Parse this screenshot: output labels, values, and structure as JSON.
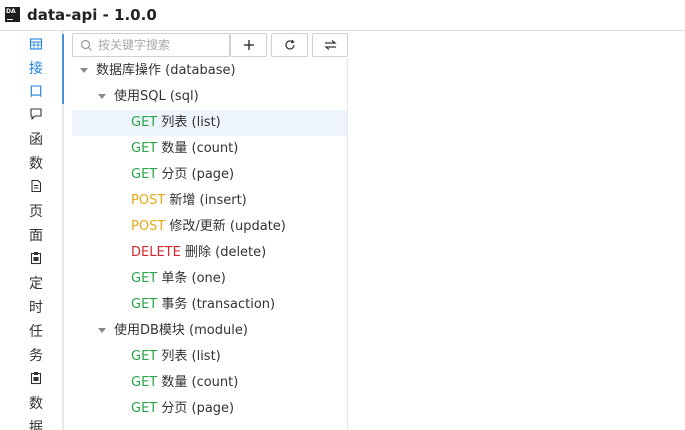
{
  "app": {
    "logo_text": "DA",
    "title": "data-api - 1.0.0"
  },
  "sidebar": {
    "items": [
      {
        "icon": "table-icon"
      },
      {
        "label": "接"
      },
      {
        "label": "口"
      },
      {
        "icon": "comment-icon"
      },
      {
        "label": "函"
      },
      {
        "label": "数"
      },
      {
        "icon": "document-icon"
      },
      {
        "label": "页"
      },
      {
        "label": "面"
      },
      {
        "icon": "clipboard-icon"
      },
      {
        "label": "定"
      },
      {
        "label": "时"
      },
      {
        "label": "任"
      },
      {
        "label": "务"
      },
      {
        "icon": "clipboard-icon"
      },
      {
        "label": "数"
      },
      {
        "label": "据"
      }
    ]
  },
  "toolbar": {
    "search_placeholder": "按关键字搜索",
    "add_icon": "plus-icon",
    "refresh_icon": "refresh-icon",
    "sort_icon": "swap-icon"
  },
  "colors": {
    "get": "#2aa44a",
    "post": "#e6a817",
    "delete": "#d1282d",
    "accent": "#1e80e0",
    "selected_bg": "#eef4fc"
  },
  "tree": [
    {
      "type": "group",
      "level": 0,
      "label": "数据库操作 (database)"
    },
    {
      "type": "group",
      "level": 1,
      "label": "使用SQL (sql)"
    },
    {
      "type": "api",
      "method": "GET",
      "name": "列表 (list)",
      "selected": true
    },
    {
      "type": "api",
      "method": "GET",
      "name": "数量 (count)"
    },
    {
      "type": "api",
      "method": "GET",
      "name": "分页 (page)"
    },
    {
      "type": "api",
      "method": "POST",
      "name": "新增 (insert)"
    },
    {
      "type": "api",
      "method": "POST",
      "name": "修改/更新 (update)"
    },
    {
      "type": "api",
      "method": "DELETE",
      "name": "删除 (delete)"
    },
    {
      "type": "api",
      "method": "GET",
      "name": "单条 (one)"
    },
    {
      "type": "api",
      "method": "GET",
      "name": "事务 (transaction)"
    },
    {
      "type": "group",
      "level": 1,
      "label": "使用DB模块 (module)"
    },
    {
      "type": "api",
      "method": "GET",
      "name": "列表 (list)"
    },
    {
      "type": "api",
      "method": "GET",
      "name": "数量 (count)"
    },
    {
      "type": "api",
      "method": "GET",
      "name": "分页 (page)"
    }
  ]
}
